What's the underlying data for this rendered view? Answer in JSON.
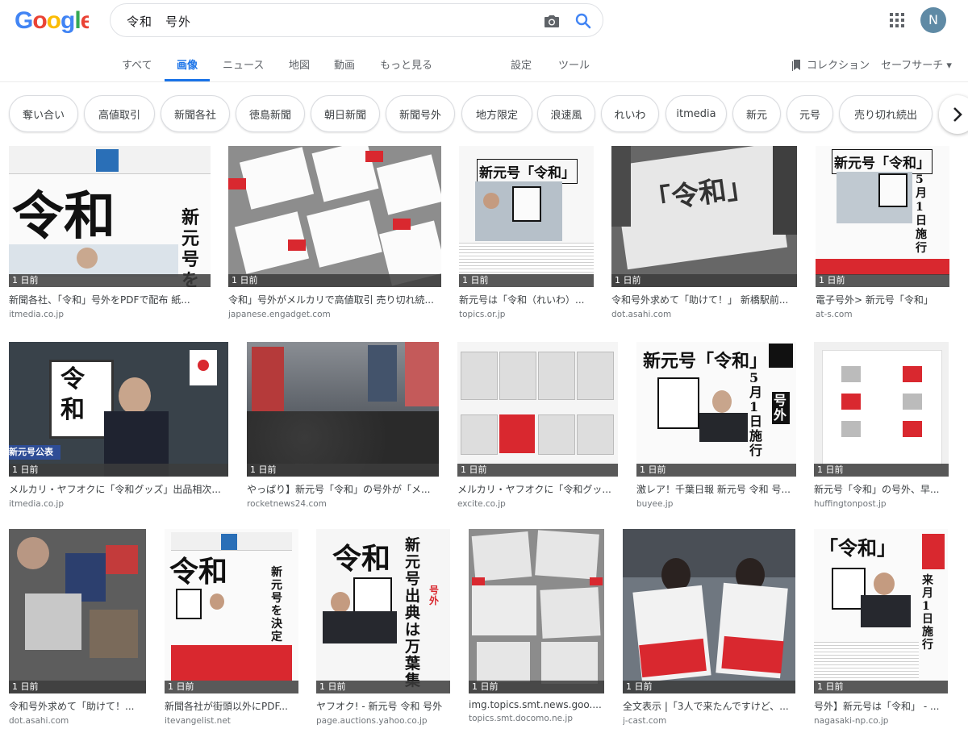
{
  "search": {
    "query": "令和　号外"
  },
  "user": {
    "initial": "N"
  },
  "tabs": [
    {
      "label": "すべて"
    },
    {
      "label": "画像"
    },
    {
      "label": "ニュース"
    },
    {
      "label": "地図"
    },
    {
      "label": "動画"
    },
    {
      "label": "もっと見る"
    },
    {
      "label": "設定"
    },
    {
      "label": "ツール"
    }
  ],
  "toolbar": {
    "collection_label": "コレクション",
    "safesearch_label": "セーフサーチ ▾"
  },
  "chips": [
    "奪い合い",
    "高値取引",
    "新聞各社",
    "徳島新聞",
    "朝日新聞",
    "新聞号外",
    "地方限定",
    "浪速風",
    "れいわ",
    "itmedia",
    "新元",
    "元号",
    "売り切れ続出"
  ],
  "results": [
    {
      "age": "1 日前",
      "title": "新聞各社、「令和」号外をPDFで配布 紙...",
      "site": "itmedia.co.jp"
    },
    {
      "age": "1 日前",
      "title": "令和」号外がメルカリで高値取引 売り切れ続...",
      "site": "japanese.engadget.com"
    },
    {
      "age": "1 日前",
      "title": "新元号は「令和（れいわ）...",
      "site": "topics.or.jp"
    },
    {
      "age": "1 日前",
      "title": "令和号外求めて「助けて！」 新橋駅前...",
      "site": "dot.asahi.com"
    },
    {
      "age": "1 日前",
      "title": "電子号外> 新元号「令和」",
      "site": "at-s.com"
    },
    {
      "age": "1 日前",
      "title": "メルカリ・ヤフオクに「令和グッズ」出品相次...",
      "site": "itmedia.co.jp"
    },
    {
      "age": "1 日前",
      "title": "やっぱり】新元号「令和」の号外が「メ...",
      "site": "rocketnews24.com"
    },
    {
      "age": "1 日前",
      "title": "メルカリ・ヤフオクに「令和グッ...",
      "site": "excite.co.jp"
    },
    {
      "age": "1 日前",
      "title": "激レア！千葉日報 新元号 令和 号...",
      "site": "buyee.jp"
    },
    {
      "age": "1 日前",
      "title": "新元号「令和」の号外、早...",
      "site": "huffingtonpost.jp"
    },
    {
      "age": "1 日前",
      "title": "令和号外求めて「助けて！...",
      "site": "dot.asahi.com"
    },
    {
      "age": "1 日前",
      "title": "新聞各社が街頭以外にPDF...",
      "site": "itevangelist.net"
    },
    {
      "age": "1 日前",
      "title": "ヤフオク! - 新元号 令和 号外",
      "site": "page.auctions.yahoo.co.jp"
    },
    {
      "age": "1 日前",
      "title": "img.topics.smt.news.goo....",
      "site": "topics.smt.docomo.ne.jp"
    },
    {
      "age": "1 日前",
      "title": "全文表示 |「3人で来たんですけど、...",
      "site": "j-cast.com"
    },
    {
      "age": "1 日前",
      "title": "号外】新元号は「令和」 - ...",
      "site": "nagasaki-np.co.jp"
    }
  ],
  "thumbnail_text": {
    "reiwa": "令和",
    "shin_gengo_reiwa": "新元号「令和」",
    "bracket_reiwa": "「令和」",
    "gogai": "号外",
    "shin_gengo_wo_kettei": "新元号を決定",
    "rei": "令",
    "wa": "和",
    "koushiki": "新元号公表",
    "shusho": "新元号 出典は万葉集",
    "sekou": "5月1日施行",
    "kami": "来月1日施行"
  },
  "colors": {
    "accent": "#1a73e8",
    "newspaper_red": "#d9282f",
    "age_bar": "#3c3c3c"
  }
}
